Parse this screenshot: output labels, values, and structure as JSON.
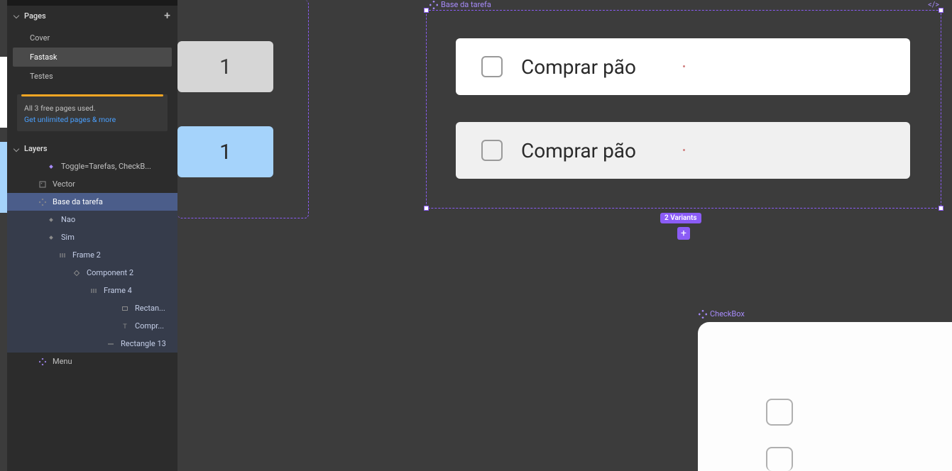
{
  "panels": {
    "pages_title": "Pages",
    "layers_title": "Layers"
  },
  "pages": {
    "items": [
      {
        "label": "Cover"
      },
      {
        "label": "Fastask"
      },
      {
        "label": "Testes"
      }
    ]
  },
  "upgrade": {
    "line1": "All 3 free pages used.",
    "link": "Get unlimited pages & more"
  },
  "layers": {
    "items": [
      {
        "label": "Toggle=Tarefas, CheckB...",
        "icon": "diamond-fill",
        "indent": 1,
        "sel": ""
      },
      {
        "label": "Vector",
        "icon": "image",
        "indent": 0,
        "sel": ""
      },
      {
        "label": "Base da tarefa",
        "icon": "component-set",
        "indent": 0,
        "sel": "sel"
      },
      {
        "label": "Nao",
        "icon": "diamond-fill",
        "indent": 1,
        "sel": "child-sel"
      },
      {
        "label": "Sim",
        "icon": "diamond-fill",
        "indent": 1,
        "sel": "child-sel"
      },
      {
        "label": "Frame 2",
        "icon": "auto-h",
        "indent": 2,
        "sel": "child-sel"
      },
      {
        "label": "Component 2",
        "icon": "diamond-outline",
        "indent": 3,
        "sel": "child-sel"
      },
      {
        "label": "Frame 4",
        "icon": "auto-h",
        "indent": 4,
        "sel": "child-sel"
      },
      {
        "label": "Rectan...",
        "icon": "rect",
        "indent": 6,
        "sel": "child-sel"
      },
      {
        "label": "Compr...",
        "icon": "text",
        "indent": 6,
        "sel": "child-sel"
      },
      {
        "label": "Rectangle 13",
        "icon": "line",
        "indent": 5,
        "sel": "child-sel"
      },
      {
        "label": "Menu",
        "icon": "component-set",
        "indent": 0,
        "sel": ""
      }
    ]
  },
  "canvas": {
    "left_cards": {
      "num1": "1",
      "num2": "1"
    },
    "component_set": {
      "title": "Base da tarefa",
      "variant_text_1": "Comprar pão",
      "variant_text_2": "Comprar pão",
      "variants_badge": "2 Variants"
    },
    "checkbox_component": {
      "title": "CheckBox"
    }
  }
}
